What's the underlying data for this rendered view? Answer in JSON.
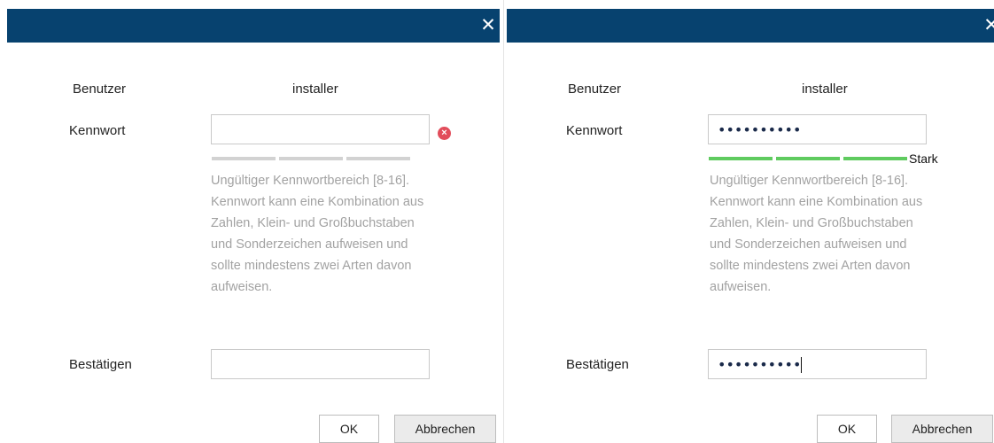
{
  "dialogs": [
    {
      "close_icon": "close-icon",
      "user_label": "Benutzer",
      "user_value": "installer",
      "password_label": "Kennwort",
      "password_value": "",
      "password_mask": "",
      "error_icon": "error-x-circle-icon",
      "strength_label": "",
      "strength_level": 0,
      "hint": "Ungültiger Kennwortbereich [8-16]. Kennwort kann eine Kombination aus Zahlen, Klein- und Großbuchstaben und Sonderzeichen aufweisen und sollte mindestens zwei Arten davon aufweisen.",
      "confirm_label": "Bestätigen",
      "confirm_mask": "",
      "ok_label": "OK",
      "cancel_label": "Abbrechen"
    },
    {
      "close_icon": "close-icon",
      "user_label": "Benutzer",
      "user_value": "installer",
      "password_label": "Kennwort",
      "password_mask": "••••••••••",
      "strength_label": "Stark",
      "strength_level": 3,
      "hint": "Ungültiger Kennwortbereich [8-16]. Kennwort kann eine Kombination aus Zahlen, Klein- und Großbuchstaben und Sonderzeichen aufweisen und sollte mindestens zwei Arten davon aufweisen.",
      "confirm_label": "Bestätigen",
      "confirm_mask": "••••••••••",
      "ok_label": "OK",
      "cancel_label": "Abbrechen"
    }
  ],
  "colors": {
    "titlebar": "#07426f",
    "error": "#e24d5b",
    "strength_strong": "#5fcb5f",
    "strength_empty": "#d2d2d2",
    "hint_text": "#a2a2a2"
  }
}
